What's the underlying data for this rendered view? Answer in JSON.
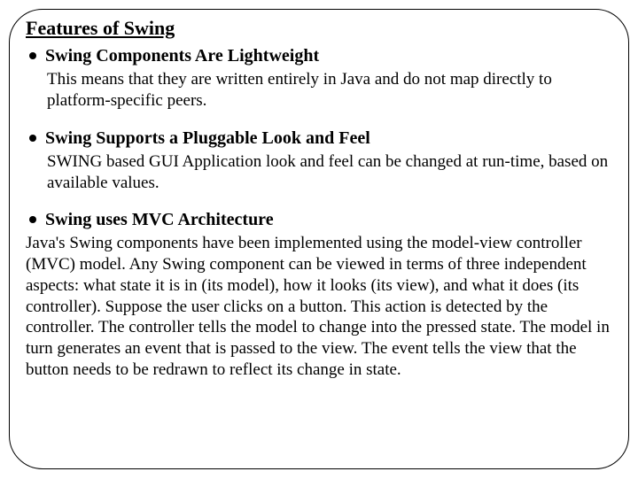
{
  "title": "Features of Swing",
  "items": [
    {
      "heading": "Swing Components Are Lightweight",
      "body": " This means that they are written entirely in Java and do not map directly to platform-specific peers.",
      "bodyFlush": false
    },
    {
      "heading": "Swing Supports a Pluggable Look and Feel",
      "body": " SWING based GUI Application look and feel can be changed at run-time, based on available values.",
      "bodyFlush": false
    },
    {
      "heading": "Swing uses MVC Architecture",
      "body": "Java's Swing components have been implemented using the model-view controller (MVC) model. Any Swing component can be viewed in terms of three independent aspects: what state it is in (its model), how it looks (its view), and what it does (its controller). Suppose the user clicks on a button. This action is detected by the controller. The controller tells the model to change into the pressed state. The model in turn generates an event that is passed to the view. The event tells the view that the button needs to be redrawn to reflect its change in state.",
      "bodyFlush": true
    }
  ]
}
